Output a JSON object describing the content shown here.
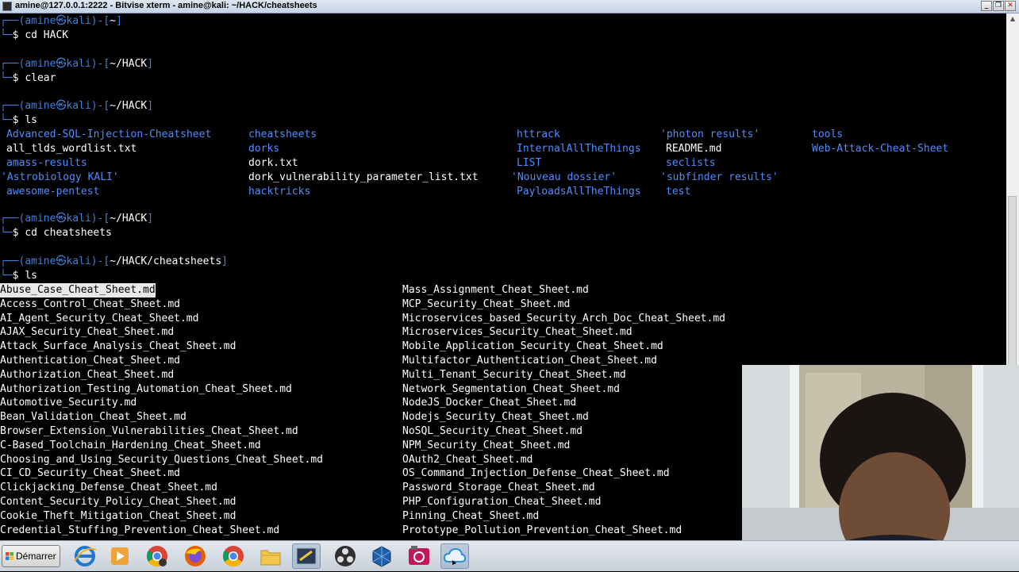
{
  "window": {
    "title": "amine@127.0.0.1:2222 - Bitvise xterm - amine@kali: ~/HACK/cheatsheets",
    "controls": [
      "_",
      "❐",
      "✕"
    ]
  },
  "terminal": {
    "prompt_user": "amine",
    "prompt_at": "㉿",
    "prompt_host": "kali",
    "dollar": "$",
    "blocks": [
      {
        "path": "~",
        "command": "cd HACK"
      },
      {
        "path": "~/HACK",
        "command": "clear"
      },
      {
        "path": "~/HACK",
        "command": "ls"
      },
      {
        "path": "~/HACK",
        "command": "cd cheatsheets"
      },
      {
        "path": "~/HACK/cheatsheets",
        "command": "ls"
      }
    ],
    "hack_ls": [
      [
        {
          "name": "Advanced-SQL-Injection-Cheatsheet",
          "type": "dir"
        },
        {
          "name": "all_tlds_wordlist.txt",
          "type": "file"
        },
        {
          "name": "amass-results",
          "type": "dir"
        },
        {
          "name": "'Astrobiology KALI'",
          "type": "dir"
        },
        {
          "name": "awesome-pentest",
          "type": "dir"
        }
      ],
      [
        {
          "name": "cheatsheets",
          "type": "dir"
        },
        {
          "name": "dorks",
          "type": "dir"
        },
        {
          "name": "dork.txt",
          "type": "file"
        },
        {
          "name": "dork_vulnerability_parameter_list.txt",
          "type": "file"
        },
        {
          "name": "hacktricks",
          "type": "dir"
        }
      ],
      [
        {
          "name": "httrack",
          "type": "dir"
        },
        {
          "name": "InternalAllTheThings",
          "type": "dir"
        },
        {
          "name": "LIST",
          "type": "dir"
        },
        {
          "name": "'Nouveau dossier'",
          "type": "dir"
        },
        {
          "name": "PayloadsAllTheThings",
          "type": "dir"
        }
      ],
      [
        {
          "name": "'photon results'",
          "type": "dir"
        },
        {
          "name": "README.md",
          "type": "file"
        },
        {
          "name": "seclists",
          "type": "dir"
        },
        {
          "name": "'subfinder results'",
          "type": "dir"
        },
        {
          "name": "test",
          "type": "dir"
        }
      ],
      [
        {
          "name": "tools",
          "type": "dir"
        },
        {
          "name": "Web-Attack-Cheat-Sheet",
          "type": "dir"
        }
      ]
    ],
    "cheatsheets_ls_left": [
      "Abuse_Case_Cheat_Sheet.md",
      "Access_Control_Cheat_Sheet.md",
      "AI_Agent_Security_Cheat_Sheet.md",
      "AJAX_Security_Cheat_Sheet.md",
      "Attack_Surface_Analysis_Cheat_Sheet.md",
      "Authentication_Cheat_Sheet.md",
      "Authorization_Cheat_Sheet.md",
      "Authorization_Testing_Automation_Cheat_Sheet.md",
      "Automotive_Security.md",
      "Bean_Validation_Cheat_Sheet.md",
      "Browser_Extension_Vulnerabilities_Cheat_Sheet.md",
      "C-Based_Toolchain_Hardening_Cheat_Sheet.md",
      "Choosing_and_Using_Security_Questions_Cheat_Sheet.md",
      "CI_CD_Security_Cheat_Sheet.md",
      "Clickjacking_Defense_Cheat_Sheet.md",
      "Content_Security_Policy_Cheat_Sheet.md",
      "Cookie_Theft_Mitigation_Cheat_Sheet.md",
      "Credential_Stuffing_Prevention_Cheat_Sheet.md"
    ],
    "cheatsheets_ls_right": [
      "Mass_Assignment_Cheat_Sheet.md",
      "MCP_Security_Cheat_Sheet.md",
      "Microservices_based_Security_Arch_Doc_Cheat_Sheet.md",
      "Microservices_Security_Cheat_Sheet.md",
      "Mobile_Application_Security_Cheat_Sheet.md",
      "Multifactor_Authentication_Cheat_Sheet.md",
      "Multi_Tenant_Security_Cheat_Sheet.md",
      "Network_Segmentation_Cheat_Sheet.md",
      "NodeJS_Docker_Cheat_Sheet.md",
      "Nodejs_Security_Cheat_Sheet.md",
      "NoSQL_Security_Cheat_Sheet.md",
      "NPM_Security_Cheat_Sheet.md",
      "OAuth2_Cheat_Sheet.md",
      "OS_Command_Injection_Defense_Cheat_Sheet.md",
      "Password_Storage_Cheat_Sheet.md",
      "PHP_Configuration_Cheat_Sheet.md",
      "Pinning_Cheat_Sheet.md",
      "Prototype_Pollution_Prevention_Cheat_Sheet.md"
    ],
    "colors": {
      "prompt": "#3f7fd8",
      "dir": "#4e8dff",
      "text": "#ffffff",
      "background": "#000000"
    }
  },
  "taskbar": {
    "start_label": "Démarrer",
    "apps": [
      {
        "icon": "internet-explorer-icon"
      },
      {
        "icon": "media-player-icon"
      },
      {
        "icon": "chrome-icon"
      },
      {
        "icon": "firefox-icon"
      },
      {
        "icon": "chrome-icon"
      },
      {
        "icon": "file-explorer-icon"
      },
      {
        "icon": "terminal-icon",
        "active": true
      },
      {
        "icon": "obs-icon"
      },
      {
        "icon": "virtualbox-icon"
      },
      {
        "icon": "screen-recorder-icon"
      },
      {
        "icon": "cloud-icon",
        "active": true
      }
    ]
  }
}
